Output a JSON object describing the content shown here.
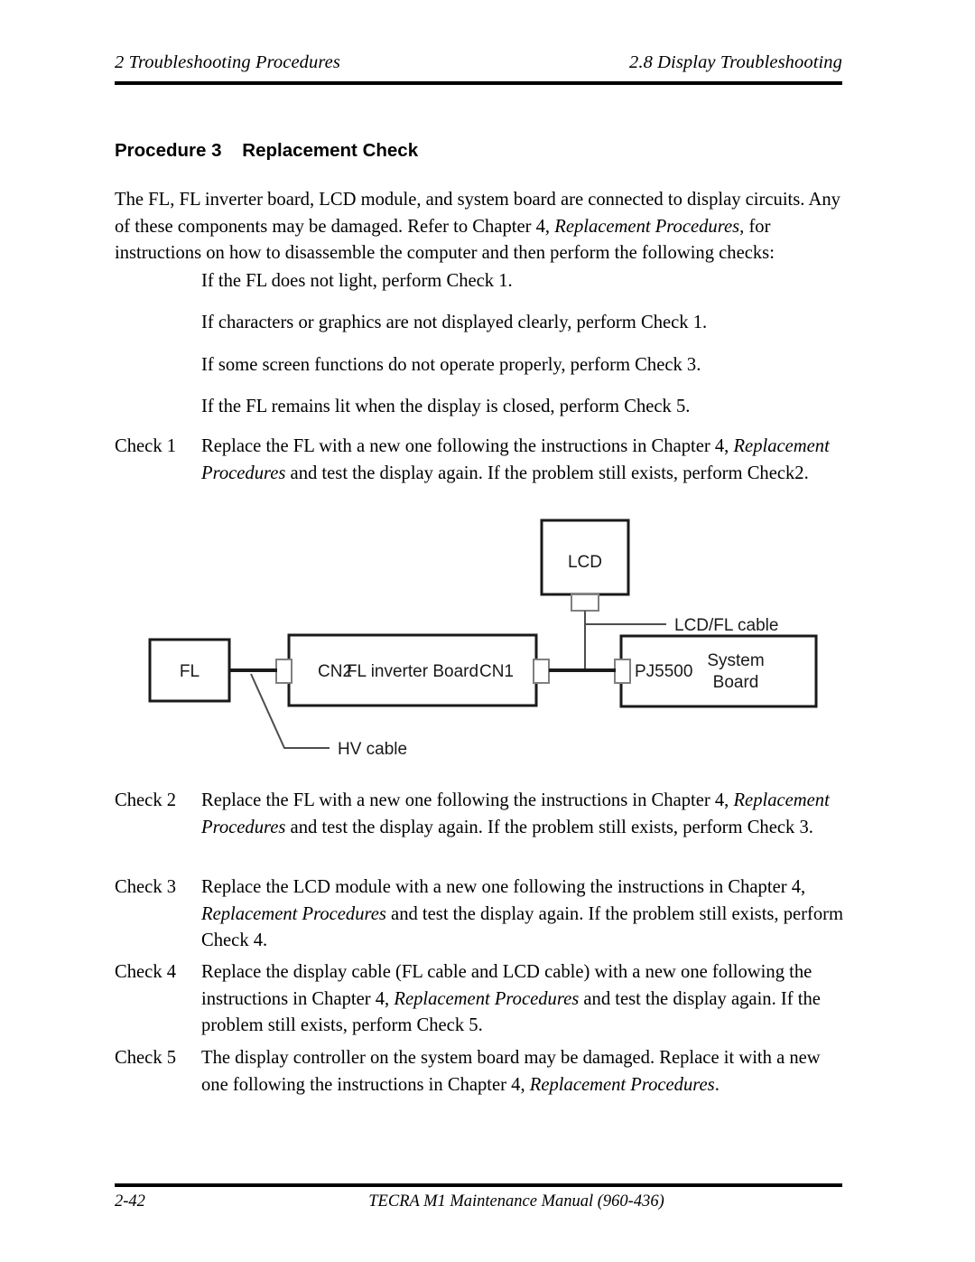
{
  "header": {
    "left": "2  Troubleshooting Procedures",
    "right": "2.8 Display Troubleshooting"
  },
  "procedure": {
    "title": "Procedure 3    Replacement Check",
    "intro_before_italic": "The FL, FL inverter board, LCD module, and system board are connected to display circuits. Any of these components may be damaged. Refer to Chapter 4, ",
    "intro_italic": "Replacement Procedures,",
    "intro_after_italic": " for instructions on how to disassemble the computer and then perform the following checks:"
  },
  "conditions": [
    "If the FL does not light, perform Check 1.",
    "If characters or graphics are not displayed clearly, perform Check 1.",
    "If some screen functions do not operate properly, perform Check 3.",
    "If the FL remains lit when the display is closed, perform Check 5."
  ],
  "checks": [
    {
      "label": "Check 1",
      "before": "Replace the FL with a new one following the instructions in Chapter 4, ",
      "italic": "Replacement Procedures",
      "after": " and test the display again. If the problem still exists, perform Check2."
    },
    {
      "label": "Check 2",
      "before": "Replace the FL with a new one following the instructions in Chapter 4, ",
      "italic": "Replacement Procedures",
      "after": " and test the display again. If the problem still exists, perform Check 3."
    },
    {
      "label": "Check 3",
      "before": "Replace the LCD module with a new one following the instructions in Chapter 4, ",
      "italic": "Replacement Procedures",
      "after": " and test the display again. If the problem still exists, perform Check 4."
    },
    {
      "label": "Check 4",
      "before": "Replace the display cable (FL cable and LCD cable) with a new one following the instructions in Chapter 4, ",
      "italic": "Replacement Procedures",
      "after": " and test the display again. If the problem still exists, perform Check 5."
    },
    {
      "label": "Check 5",
      "before": "The display controller on the system board may be damaged. Replace it with a new one following the instructions in Chapter 4, ",
      "italic": "Replacement Procedures",
      "after": "."
    }
  ],
  "diagram": {
    "blocks": {
      "lcd": "LCD",
      "fl": "FL",
      "inverter": "FL inverter Board",
      "system_line1": "System",
      "system_line2": "Board"
    },
    "connectors": {
      "cn2": "CN2",
      "cn1": "CN1",
      "pj5500": "PJ5500"
    },
    "cables": {
      "lcd_fl": "LCD/FL cable",
      "hv": "HV cable"
    },
    "colors": {
      "outline": "#1a1a1a",
      "connector_outline": "#808080",
      "cable": "#1a1a1a",
      "leader": "#4d4d4d"
    }
  },
  "footer": {
    "page": "2-42",
    "manual": "TECRA M1 Maintenance Manual (960-436)"
  }
}
